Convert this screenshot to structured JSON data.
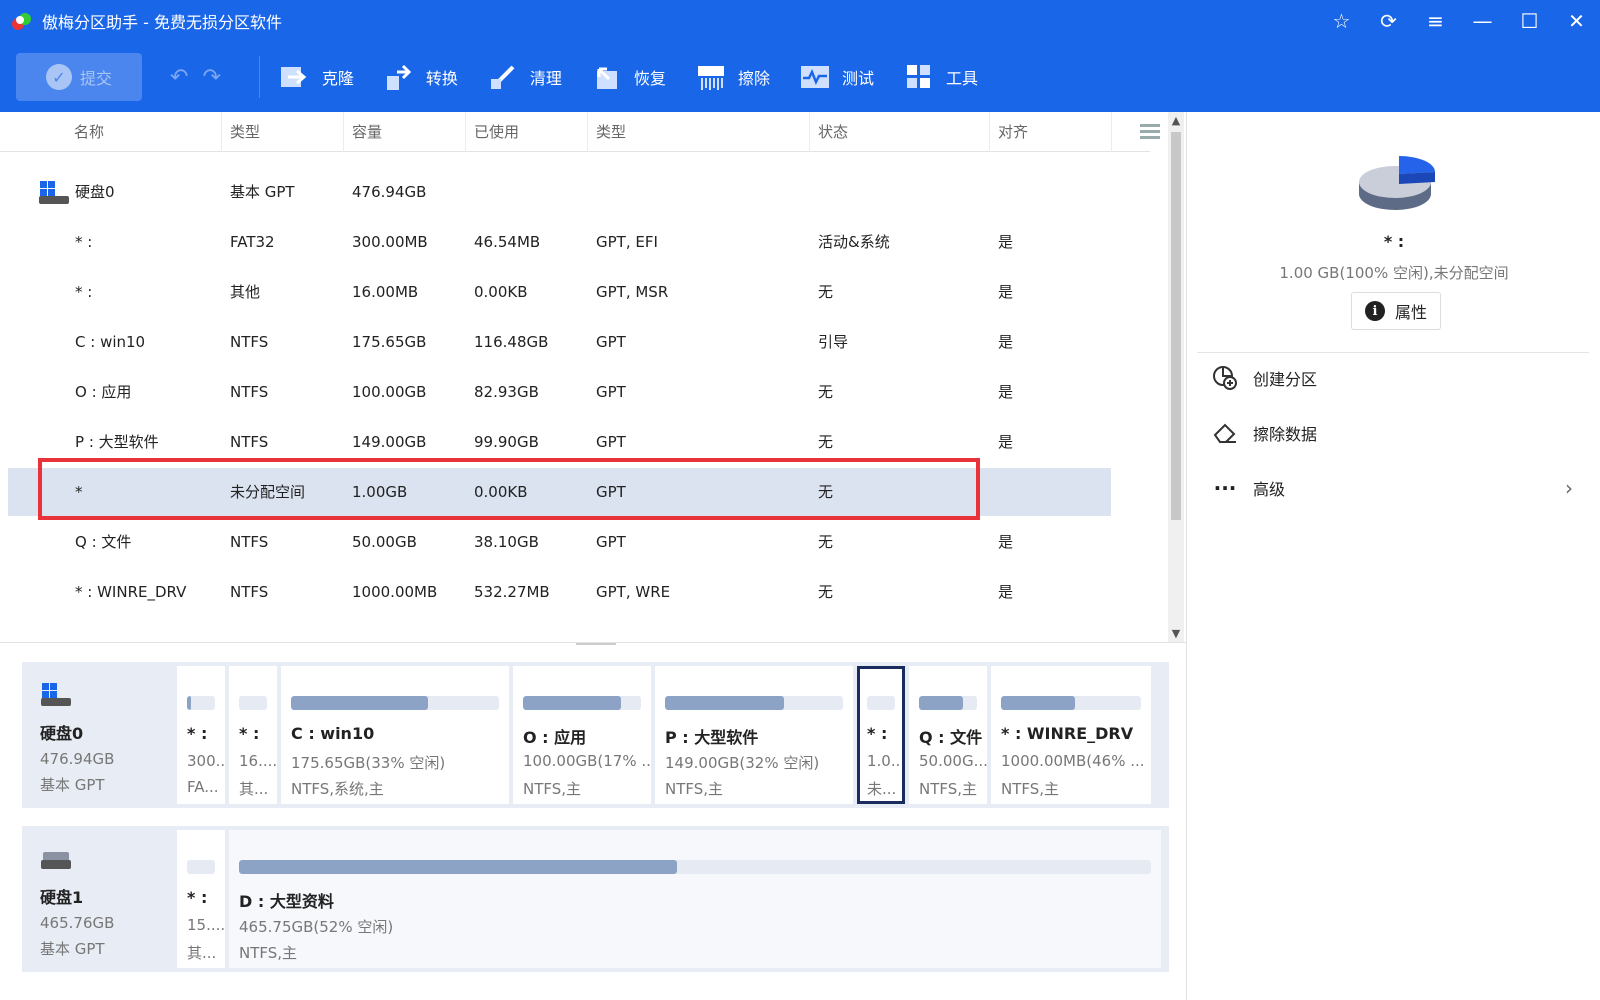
{
  "window": {
    "title": "傲梅分区助手 - 免费无损分区软件"
  },
  "toolbar": {
    "submit_label": "提交",
    "tools": [
      {
        "label": "克隆",
        "icon": "clone-icon"
      },
      {
        "label": "转换",
        "icon": "convert-icon"
      },
      {
        "label": "清理",
        "icon": "cleanup-icon"
      },
      {
        "label": "恢复",
        "icon": "recover-icon"
      },
      {
        "label": "擦除",
        "icon": "wipe-icon"
      },
      {
        "label": "测试",
        "icon": "test-icon"
      },
      {
        "label": "工具",
        "icon": "tools-icon"
      }
    ]
  },
  "table": {
    "headers": [
      "名称",
      "类型",
      "容量",
      "已使用",
      "类型",
      "状态",
      "对齐"
    ],
    "rows": [
      {
        "name": "硬盘0",
        "type": "基本 GPT",
        "capacity": "476.94GB",
        "used": "",
        "ptype": "",
        "status": "",
        "align": "",
        "is_disk": true
      },
      {
        "name": "* :",
        "type": "FAT32",
        "capacity": "300.00MB",
        "used": "46.54MB",
        "ptype": "GPT, EFI",
        "status": "活动&系统",
        "align": "是"
      },
      {
        "name": "* :",
        "type": "其他",
        "capacity": "16.00MB",
        "used": "0.00KB",
        "ptype": "GPT, MSR",
        "status": "无",
        "align": "是"
      },
      {
        "name": "C : win10",
        "type": "NTFS",
        "capacity": "175.65GB",
        "used": "116.48GB",
        "ptype": "GPT",
        "status": "引导",
        "align": "是"
      },
      {
        "name": "O : 应用",
        "type": "NTFS",
        "capacity": "100.00GB",
        "used": "82.93GB",
        "ptype": "GPT",
        "status": "无",
        "align": "是"
      },
      {
        "name": "P : 大型软件",
        "type": "NTFS",
        "capacity": "149.00GB",
        "used": "99.90GB",
        "ptype": "GPT",
        "status": "无",
        "align": "是"
      },
      {
        "name": "*",
        "type": "未分配空间",
        "capacity": "1.00GB",
        "used": "0.00KB",
        "ptype": "GPT",
        "status": "无",
        "align": "",
        "selected": true
      },
      {
        "name": "Q : 文件",
        "type": "NTFS",
        "capacity": "50.00GB",
        "used": "38.10GB",
        "ptype": "GPT",
        "status": "无",
        "align": "是"
      },
      {
        "name": "* : WINRE_DRV",
        "type": "NTFS",
        "capacity": "1000.00MB",
        "used": "532.27MB",
        "ptype": "GPT, WRE",
        "status": "无",
        "align": "是"
      }
    ]
  },
  "disks": [
    {
      "name": "硬盘0",
      "size": "476.94GB",
      "type": "基本 GPT",
      "partitions": [
        {
          "name": "* :",
          "l1": "300...",
          "l2": "FA...",
          "used_pct": 16
        },
        {
          "name": "* :",
          "l1": "16....",
          "l2": "其...",
          "used_pct": 0
        },
        {
          "name": "C : win10",
          "l1": "175.65GB(33% 空闲)",
          "l2": "NTFS,系统,主",
          "used_pct": 66
        },
        {
          "name": "O : 应用",
          "l1": "100.00GB(17% ...",
          "l2": "NTFS,主",
          "used_pct": 83
        },
        {
          "name": "P : 大型软件",
          "l1": "149.00GB(32% 空闲)",
          "l2": "NTFS,主",
          "used_pct": 67
        },
        {
          "name": "* :",
          "l1": "1.0...",
          "l2": "未...",
          "used_pct": 0,
          "active": true
        },
        {
          "name": "Q : 文件",
          "l1": "50.00G...",
          "l2": "NTFS,主",
          "used_pct": 76
        },
        {
          "name": "* : WINRE_DRV",
          "l1": "1000.00MB(46% ...",
          "l2": "NTFS,主",
          "used_pct": 53
        }
      ]
    },
    {
      "name": "硬盘1",
      "size": "465.76GB",
      "type": "基本 GPT",
      "partitions": [
        {
          "name": "* :",
          "l1": "15....",
          "l2": "其...",
          "used_pct": 0
        },
        {
          "name": "D : 大型资料",
          "l1": "465.75GB(52% 空闲)",
          "l2": "NTFS,主",
          "used_pct": 48,
          "pale": true
        }
      ]
    }
  ],
  "right_panel": {
    "title": "* :",
    "subtitle": "1.00 GB(100% 空闲),未分配空间",
    "properties_label": "属性",
    "actions": [
      {
        "label": "创建分区",
        "icon": "create-partition-icon"
      },
      {
        "label": "擦除数据",
        "icon": "eraser-icon"
      },
      {
        "label": "高级",
        "icon": "more-dots-icon",
        "has_submenu": true
      }
    ]
  },
  "colors": {
    "titlebar": "#1a66e8",
    "selection_row": "#dbe3f0",
    "selection_box": "#e8333a",
    "bar_fill": "#8da3c6"
  }
}
